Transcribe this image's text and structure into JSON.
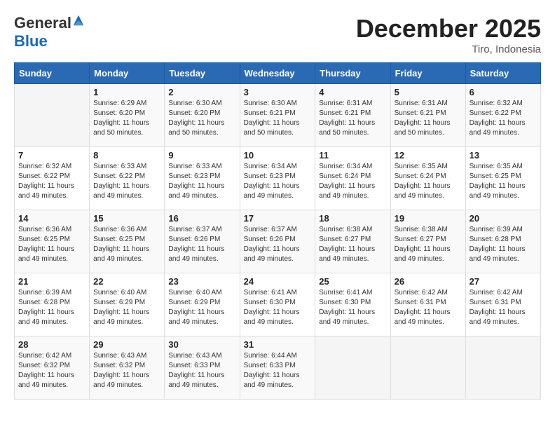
{
  "header": {
    "logo_general": "General",
    "logo_blue": "Blue",
    "month_title": "December 2025",
    "location": "Tiro, Indonesia"
  },
  "days_of_week": [
    "Sunday",
    "Monday",
    "Tuesday",
    "Wednesday",
    "Thursday",
    "Friday",
    "Saturday"
  ],
  "weeks": [
    [
      {
        "day": "",
        "info": ""
      },
      {
        "day": "1",
        "info": "Sunrise: 6:29 AM\nSunset: 6:20 PM\nDaylight: 11 hours\nand 50 minutes."
      },
      {
        "day": "2",
        "info": "Sunrise: 6:30 AM\nSunset: 6:20 PM\nDaylight: 11 hours\nand 50 minutes."
      },
      {
        "day": "3",
        "info": "Sunrise: 6:30 AM\nSunset: 6:21 PM\nDaylight: 11 hours\nand 50 minutes."
      },
      {
        "day": "4",
        "info": "Sunrise: 6:31 AM\nSunset: 6:21 PM\nDaylight: 11 hours\nand 50 minutes."
      },
      {
        "day": "5",
        "info": "Sunrise: 6:31 AM\nSunset: 6:21 PM\nDaylight: 11 hours\nand 50 minutes."
      },
      {
        "day": "6",
        "info": "Sunrise: 6:32 AM\nSunset: 6:22 PM\nDaylight: 11 hours\nand 49 minutes."
      }
    ],
    [
      {
        "day": "7",
        "info": "Sunrise: 6:32 AM\nSunset: 6:22 PM\nDaylight: 11 hours\nand 49 minutes."
      },
      {
        "day": "8",
        "info": "Sunrise: 6:33 AM\nSunset: 6:22 PM\nDaylight: 11 hours\nand 49 minutes."
      },
      {
        "day": "9",
        "info": "Sunrise: 6:33 AM\nSunset: 6:23 PM\nDaylight: 11 hours\nand 49 minutes."
      },
      {
        "day": "10",
        "info": "Sunrise: 6:34 AM\nSunset: 6:23 PM\nDaylight: 11 hours\nand 49 minutes."
      },
      {
        "day": "11",
        "info": "Sunrise: 6:34 AM\nSunset: 6:24 PM\nDaylight: 11 hours\nand 49 minutes."
      },
      {
        "day": "12",
        "info": "Sunrise: 6:35 AM\nSunset: 6:24 PM\nDaylight: 11 hours\nand 49 minutes."
      },
      {
        "day": "13",
        "info": "Sunrise: 6:35 AM\nSunset: 6:25 PM\nDaylight: 11 hours\nand 49 minutes."
      }
    ],
    [
      {
        "day": "14",
        "info": "Sunrise: 6:36 AM\nSunset: 6:25 PM\nDaylight: 11 hours\nand 49 minutes."
      },
      {
        "day": "15",
        "info": "Sunrise: 6:36 AM\nSunset: 6:25 PM\nDaylight: 11 hours\nand 49 minutes."
      },
      {
        "day": "16",
        "info": "Sunrise: 6:37 AM\nSunset: 6:26 PM\nDaylight: 11 hours\nand 49 minutes."
      },
      {
        "day": "17",
        "info": "Sunrise: 6:37 AM\nSunset: 6:26 PM\nDaylight: 11 hours\nand 49 minutes."
      },
      {
        "day": "18",
        "info": "Sunrise: 6:38 AM\nSunset: 6:27 PM\nDaylight: 11 hours\nand 49 minutes."
      },
      {
        "day": "19",
        "info": "Sunrise: 6:38 AM\nSunset: 6:27 PM\nDaylight: 11 hours\nand 49 minutes."
      },
      {
        "day": "20",
        "info": "Sunrise: 6:39 AM\nSunset: 6:28 PM\nDaylight: 11 hours\nand 49 minutes."
      }
    ],
    [
      {
        "day": "21",
        "info": "Sunrise: 6:39 AM\nSunset: 6:28 PM\nDaylight: 11 hours\nand 49 minutes."
      },
      {
        "day": "22",
        "info": "Sunrise: 6:40 AM\nSunset: 6:29 PM\nDaylight: 11 hours\nand 49 minutes."
      },
      {
        "day": "23",
        "info": "Sunrise: 6:40 AM\nSunset: 6:29 PM\nDaylight: 11 hours\nand 49 minutes."
      },
      {
        "day": "24",
        "info": "Sunrise: 6:41 AM\nSunset: 6:30 PM\nDaylight: 11 hours\nand 49 minutes."
      },
      {
        "day": "25",
        "info": "Sunrise: 6:41 AM\nSunset: 6:30 PM\nDaylight: 11 hours\nand 49 minutes."
      },
      {
        "day": "26",
        "info": "Sunrise: 6:42 AM\nSunset: 6:31 PM\nDaylight: 11 hours\nand 49 minutes."
      },
      {
        "day": "27",
        "info": "Sunrise: 6:42 AM\nSunset: 6:31 PM\nDaylight: 11 hours\nand 49 minutes."
      }
    ],
    [
      {
        "day": "28",
        "info": "Sunrise: 6:42 AM\nSunset: 6:32 PM\nDaylight: 11 hours\nand 49 minutes."
      },
      {
        "day": "29",
        "info": "Sunrise: 6:43 AM\nSunset: 6:32 PM\nDaylight: 11 hours\nand 49 minutes."
      },
      {
        "day": "30",
        "info": "Sunrise: 6:43 AM\nSunset: 6:33 PM\nDaylight: 11 hours\nand 49 minutes."
      },
      {
        "day": "31",
        "info": "Sunrise: 6:44 AM\nSunset: 6:33 PM\nDaylight: 11 hours\nand 49 minutes."
      },
      {
        "day": "",
        "info": ""
      },
      {
        "day": "",
        "info": ""
      },
      {
        "day": "",
        "info": ""
      }
    ]
  ]
}
